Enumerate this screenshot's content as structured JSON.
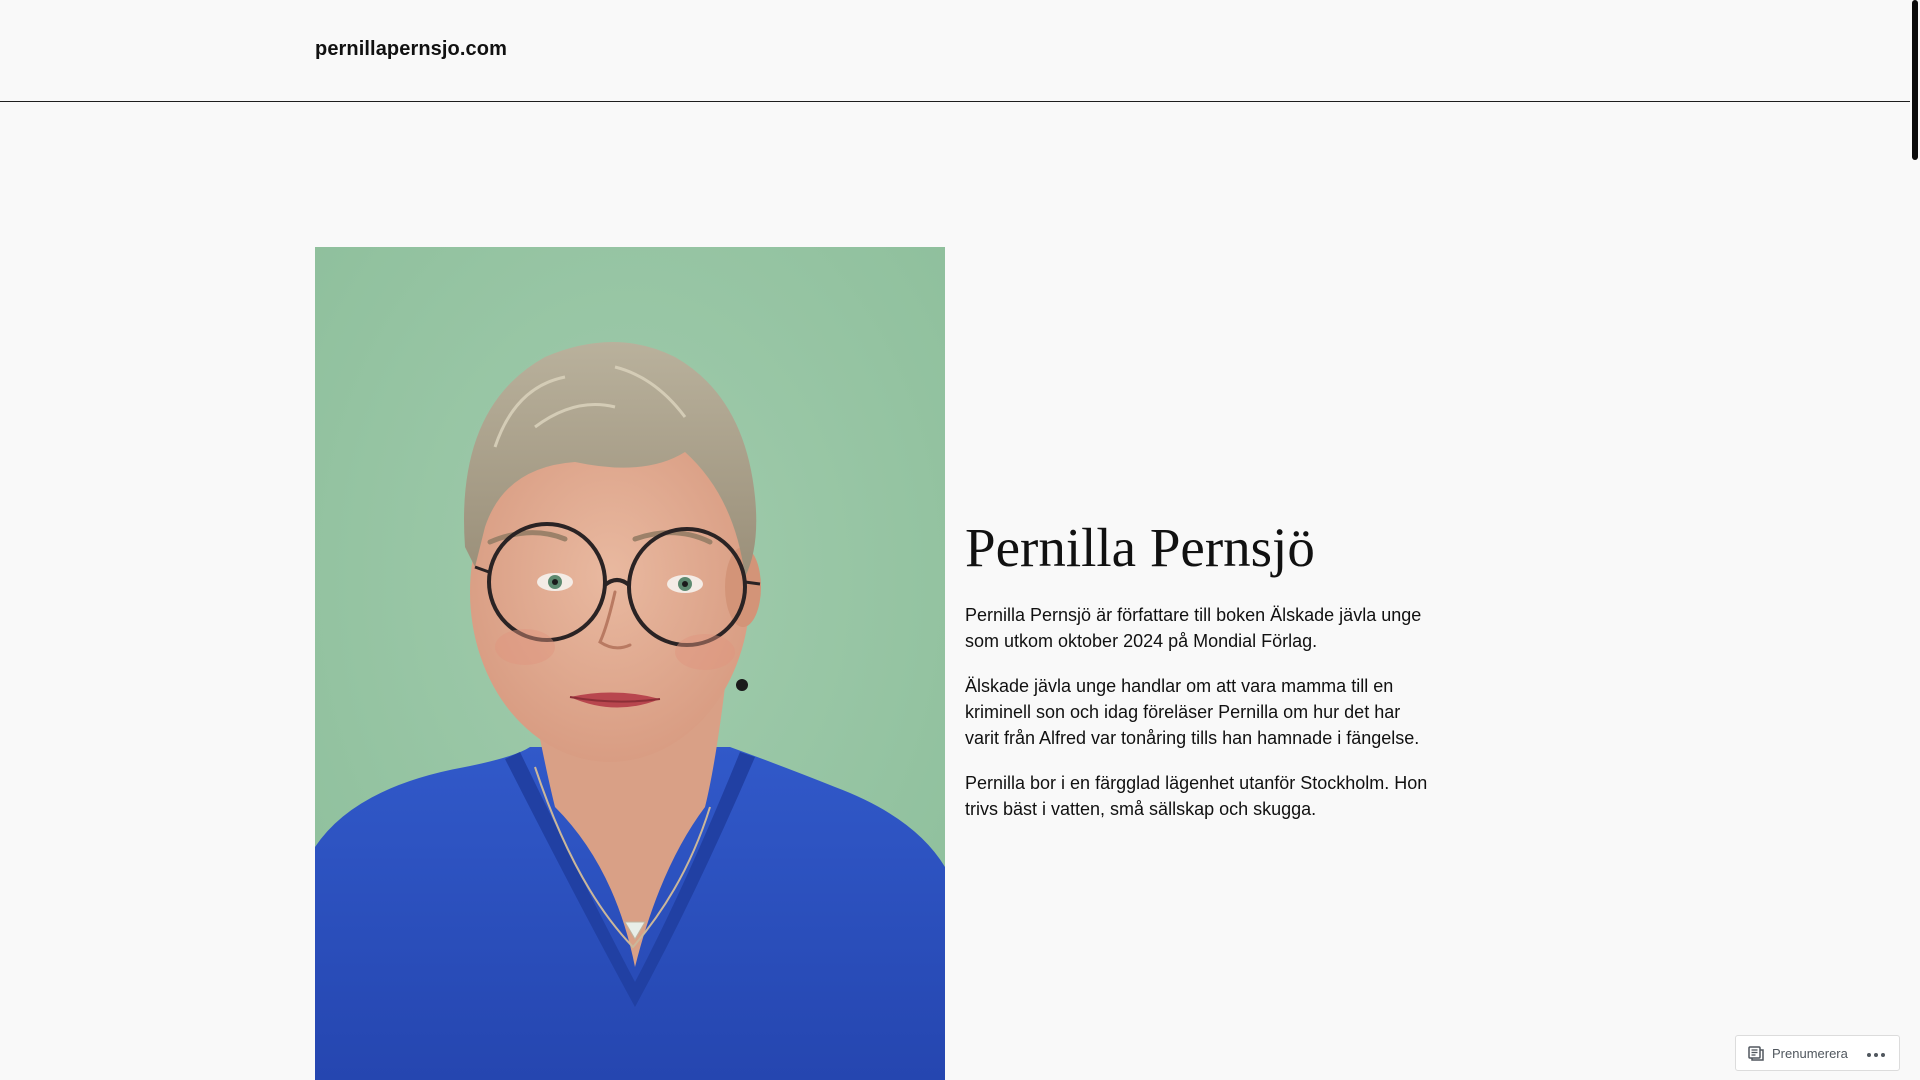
{
  "header": {
    "site_title": "pernillapernsjo.com"
  },
  "bio": {
    "heading": "Pernilla Pernsjö",
    "paragraphs": [
      "Pernilla Pernsjö är författare till boken Älskade jävla unge som utkom oktober 2024 på Mondial Förlag.",
      "Älskade jävla unge handlar om att vara mamma till en kriminell son och idag föreläser Pernilla om hur det har varit från Alfred var tonåring tills han hamnade i fängelse.",
      "Pernilla bor i en färgglad lägenhet utanför Stockholm. Hon trivs bäst i vatten, små sällskap och skugga."
    ]
  },
  "subscribe_bar": {
    "subscribe_label": "Prenumerera",
    "subscribe_icon": "reader-icon",
    "more_icon": "ellipsis-icon"
  },
  "colors": {
    "background": "#f9f9f9",
    "text": "#111111",
    "portrait_background": "#94c3a2",
    "shirt": "#2a4fbf"
  }
}
